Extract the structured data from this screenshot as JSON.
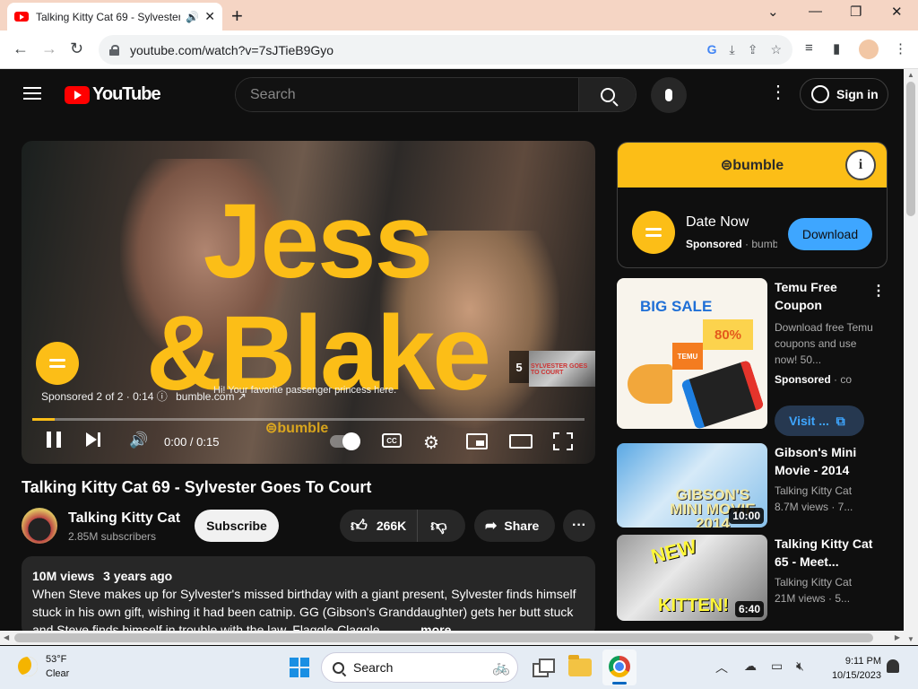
{
  "browser": {
    "tab_title": "Talking Kitty Cat 69 - Sylvester Goes To Court",
    "new_tab": "+",
    "url": "youtube.com/watch?v=7sJTieB9Gyo",
    "window_controls": [
      "⌄",
      "—",
      "❐",
      "✕"
    ]
  },
  "youtube": {
    "logo": "YouTube",
    "search_placeholder": "Search",
    "signin_label": "Sign in"
  },
  "player": {
    "ad_headline_line1": "Jess",
    "ad_headline_line2": "&Blake",
    "sponsored": "Sponsored 2 of 2 · 0:14 ⓘ",
    "ad_url": "bumble.com ↗",
    "caption": "Hi! Your favorite passenger princess here.",
    "watermark": "⊜bumble",
    "skip_count": "5",
    "skip_thumb_label": "SYLVESTER GOES TO COURT",
    "time": "0:00 / 0:15",
    "progress_fraction": 0.04,
    "cc_label": "CC"
  },
  "video": {
    "title": "Talking Kitty Cat 69 - Sylvester Goes To Court",
    "channel": "Talking Kitty Cat",
    "subscribers": "2.85M subscribers",
    "subscribe_label": "Subscribe",
    "likes": "266K",
    "share_label": "Share",
    "views": "10M views",
    "age": "3 years ago",
    "description": "When Steve makes up for Sylvester's missed birthday with a giant present, Sylvester finds himself stuck in his own gift, wishing it had been catnip. GG (Gibson's Granddaughter) gets her butt stuck and Steve finds himself in trouble with the law. Flaggle Claggle",
    "more_label": "...more"
  },
  "ad_card": {
    "brand": "⊜bumble",
    "name": "Date Now",
    "sponsored": "Sponsored",
    "domain": "bumble.com",
    "download_label": "Download"
  },
  "recs": [
    {
      "title": "Temu Free Coupon",
      "line1": "Download free Temu coupons and use now! 50...",
      "line2_bold": "Sponsored",
      "line2": "· co",
      "visit_label": "Visit ...",
      "thumb_big": "BIG SALE",
      "thumb_pct": "80%",
      "thumb_brand": "TEMU"
    },
    {
      "title": "Gibson's Mini Movie - 2014",
      "channel": "Talking Kitty Cat",
      "meta": "8.7M views · 7...",
      "duration": "10:00",
      "thumb_label": "GIBSON'S MINI MOVIE 2014"
    },
    {
      "title": "Talking Kitty Cat 65 - Meet...",
      "channel": "Talking Kitty Cat",
      "meta": "21M views · 5...",
      "duration": "6:40",
      "thumb_new": "NEW",
      "thumb_kitten": "KITTEN!"
    }
  ],
  "taskbar": {
    "temp": "53°F",
    "condition": "Clear",
    "search_label": "Search",
    "time": "9:11 PM",
    "date": "10/15/2023"
  }
}
